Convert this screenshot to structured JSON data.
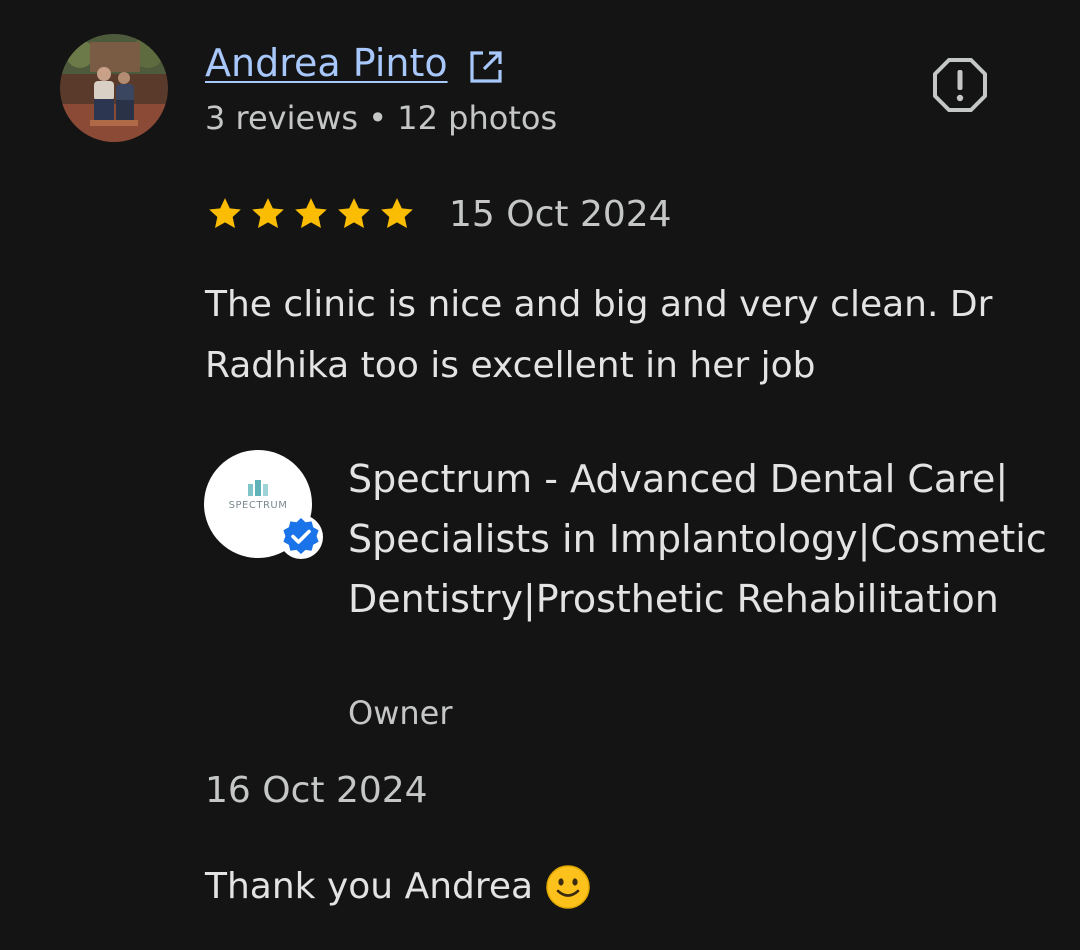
{
  "reviewer": {
    "name": "Andrea Pinto",
    "meta": "3 reviews • 12 photos",
    "avatar_icon": "profile-photo"
  },
  "icons": {
    "external_link": "external-link-icon",
    "report": "report-icon",
    "verified": "verified-badge-icon",
    "smile": "smiling-face-emoji"
  },
  "review": {
    "rating": 5,
    "rating_max": 5,
    "date": "15 Oct 2024",
    "text": "The clinic is nice and big and very clean. Dr Radhika too is excellent in her job"
  },
  "owner_reply": {
    "logo_text": "SPECTRUM",
    "business_name": "Spectrum - Advanced Dental Care| Specialists in Implantology|Cosmetic Dentistry|Prosthetic Rehabilitation",
    "role": "Owner",
    "date": "16 Oct 2024",
    "text": "Thank you Andrea"
  },
  "colors": {
    "background": "#141414",
    "link": "#a8c7fa",
    "star": "#fbbc04",
    "verified": "#1a73e8"
  }
}
